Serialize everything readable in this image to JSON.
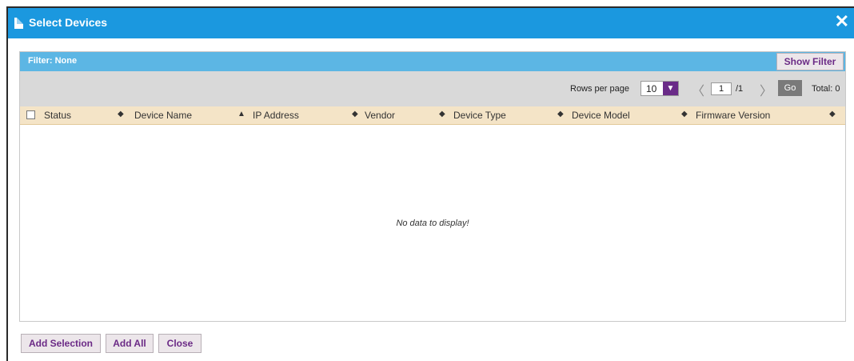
{
  "dialog": {
    "title": "Select Devices",
    "close_symbol": "✕"
  },
  "filter": {
    "label": "Filter: None",
    "show_button": "Show Filter"
  },
  "pager": {
    "rows_label": "Rows per page",
    "rows_value": "10",
    "prev_symbol": "〈",
    "next_symbol": "〉",
    "page_value": "1",
    "page_total": "/1",
    "go_label": "Go",
    "total_label": "Total: 0"
  },
  "table": {
    "columns": [
      "Status",
      "Device Name",
      "IP Address",
      "Vendor",
      "Device Type",
      "Device Model",
      "Firmware Version"
    ],
    "sort_icons": [
      "◆",
      "▲",
      "◆",
      "◆",
      "◆",
      "◆",
      "◆"
    ],
    "empty_message": "No data to display!"
  },
  "footer": {
    "add_selection": "Add Selection",
    "add_all": "Add All",
    "close": "Close"
  },
  "colors": {
    "titlebar": "#1b98df",
    "filterbar": "#5cb6e4",
    "accent_purple": "#6a2b88",
    "header_row": "#f4e4c7"
  },
  "icons": {
    "title": "document-icon",
    "close": "close-icon",
    "sort": "sort-icon",
    "dropdown": "chevron-down-icon"
  }
}
